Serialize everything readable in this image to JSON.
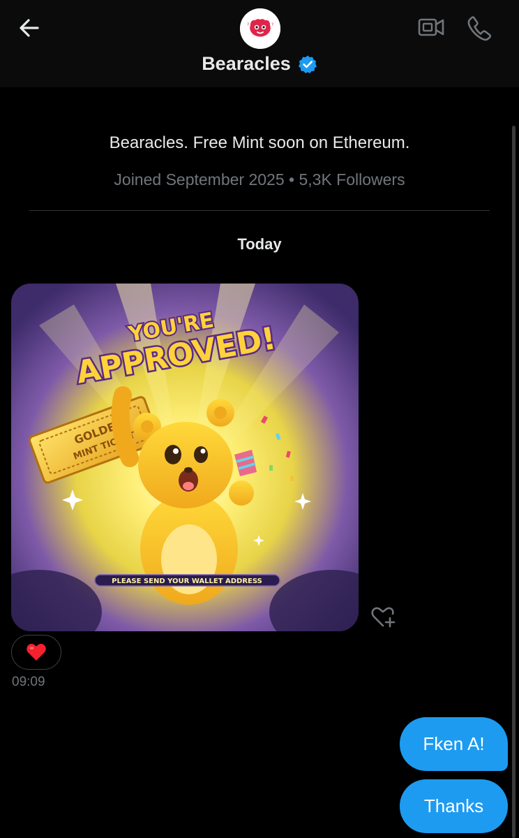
{
  "header": {
    "title": "Bearacles",
    "back_icon": "arrow-left-icon",
    "video_icon": "video-camera-icon",
    "call_icon": "phone-icon",
    "verified_icon": "verified-badge-icon",
    "verified_color": "#1d9bf0"
  },
  "profile": {
    "bio": "Bearacles. Free Mint soon on Ethereum.",
    "meta": "Joined September 2025 • 5,3K Followers"
  },
  "conversation": {
    "day_label": "Today",
    "image_message": {
      "headline_top": "YOU'RE",
      "headline_main": "APPROVED!",
      "ticket_line1": "GOLDEN",
      "ticket_line2": "MINT TICKET",
      "banner": "PLEASE SEND YOUR WALLET ADDRESS",
      "reaction": "❤️",
      "time": "09:09",
      "add_reaction_icon": "heart-plus-icon"
    },
    "outgoing": [
      {
        "text": "Fken A!"
      },
      {
        "text": "Thanks"
      }
    ]
  },
  "colors": {
    "background": "#000000",
    "accent": "#1d9bf0",
    "muted_text": "#71767b"
  }
}
